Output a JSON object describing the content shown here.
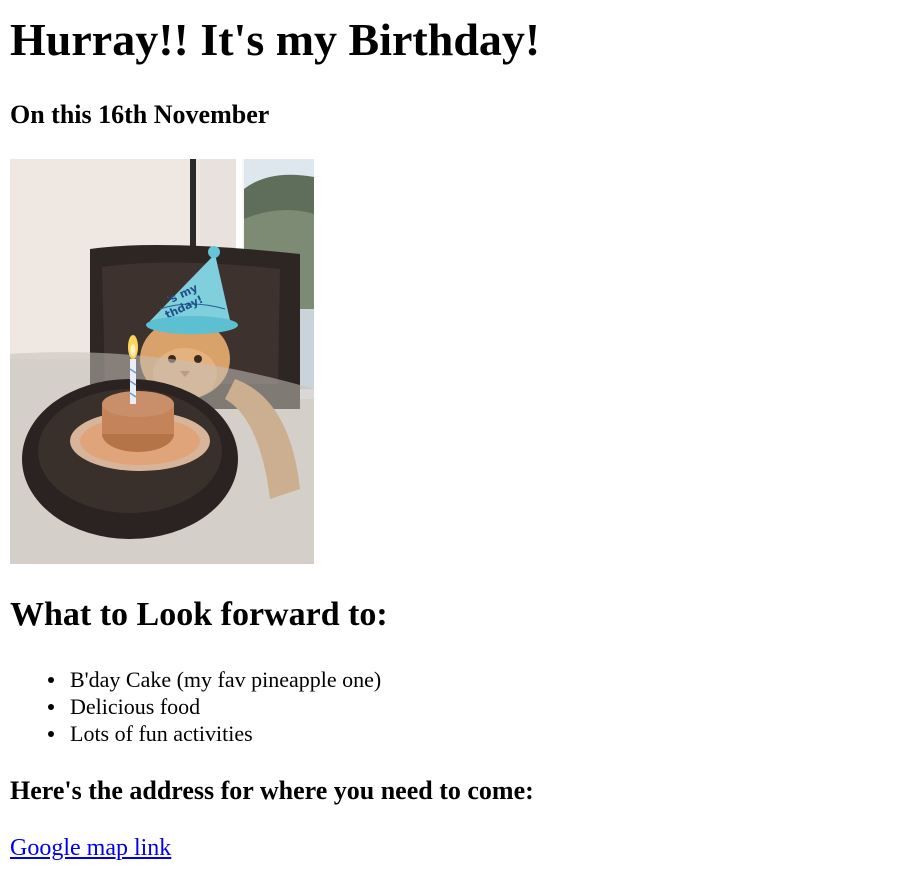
{
  "header": {
    "title": "Hurray!! It's my Birthday!",
    "subtitle": "On this 16th November"
  },
  "photo": {
    "hat_text_line1": "'s my",
    "hat_text_line2": "thday!"
  },
  "section": {
    "heading": "What to Look forward to:",
    "items": [
      "B'day Cake (my fav pineapple one)",
      "Delicious food",
      "Lots of fun activities"
    ]
  },
  "address": {
    "heading": "Here's the address for where you need to come:",
    "link_label": "Google map link"
  },
  "colors": {
    "link": "#0000ee",
    "text": "#000000"
  }
}
